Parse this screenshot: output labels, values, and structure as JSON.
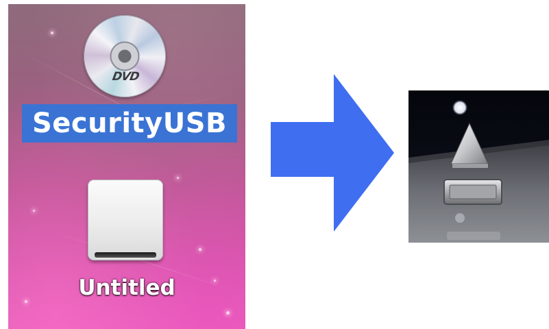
{
  "desktop": {
    "dvd_volume": {
      "icon": "dvd-disc-icon",
      "logo_text": "DVD",
      "label": "SecurityUSB",
      "selected": true
    },
    "drive_volume": {
      "icon": "external-drive-icon",
      "label": "Untitled"
    }
  },
  "arrow": {
    "icon": "right-arrow-icon",
    "color": "#3f6ef0"
  },
  "result_icon": {
    "icon": "boot-camp-eject-icon"
  },
  "colors": {
    "selection_blue": "#3a73d4",
    "desktop_pink": "#cf59a9"
  }
}
